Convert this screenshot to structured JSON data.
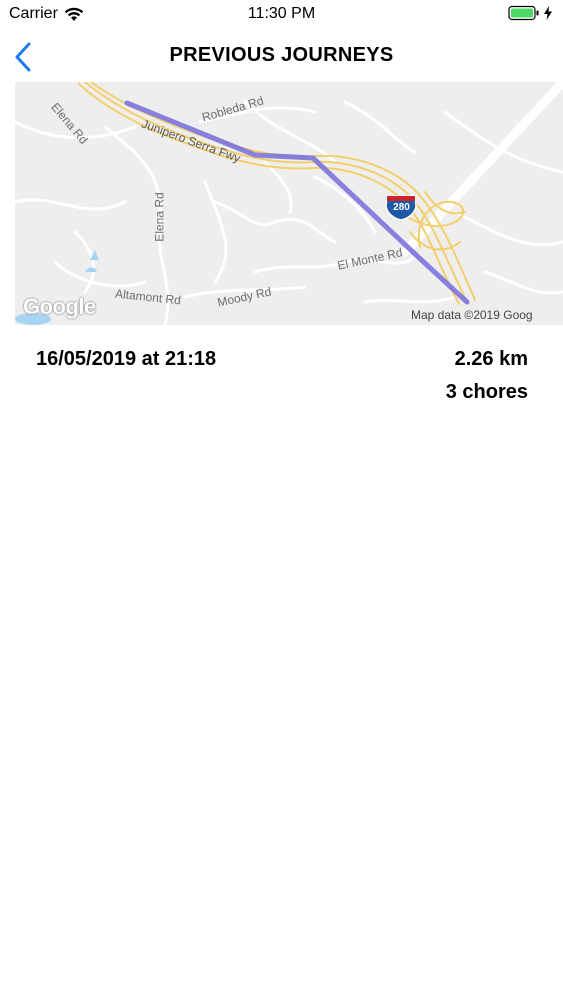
{
  "status_bar": {
    "carrier": "Carrier",
    "time": "11:30 PM"
  },
  "nav": {
    "title": "PREVIOUS JOURNEYS",
    "back_icon": "chevron-left-icon"
  },
  "map": {
    "labels": {
      "elena_rd_top": "Elena Rd",
      "robleda_rd": "Robleda Rd",
      "junipero_serra": "Junipero Serra Fwy",
      "elena_rd_mid": "Elena Rd",
      "interstate": "280",
      "el_monte_rd": "El Monte Rd",
      "altamont_rd": "Altamont Rd",
      "moody_rd": "Moody Rd"
    },
    "logo": "Google",
    "attribution": "Map data ©2019 Goog"
  },
  "journeys": [
    {
      "date": "16/05/2019 at 21:18",
      "distance": "2.26 km",
      "chores": "3 chores"
    }
  ],
  "colors": {
    "accent": "#1a7cf0",
    "route": "#7b73dc",
    "highway": "#f7d77a",
    "battery": "#4cd964"
  }
}
